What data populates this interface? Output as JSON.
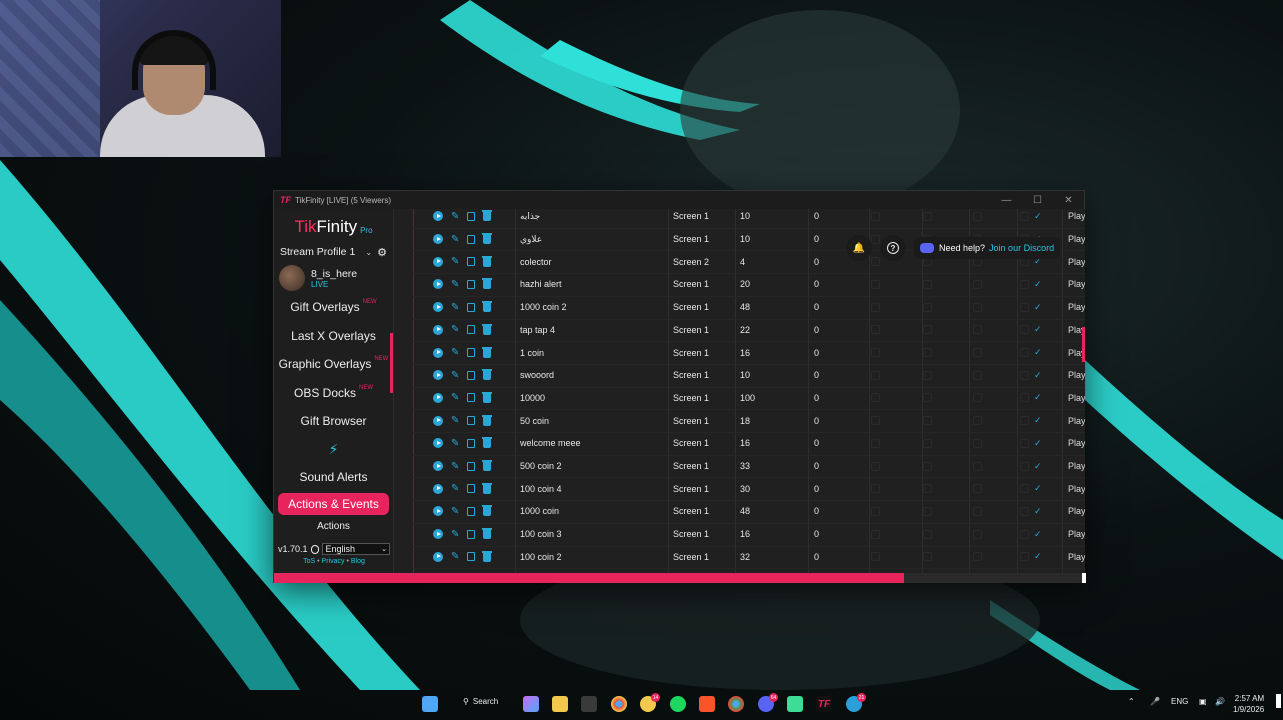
{
  "window": {
    "title": "TikFinity [LIVE] (5 Viewers)",
    "logo_short": "TF",
    "controls": [
      "—",
      "☐",
      "✕"
    ]
  },
  "brand": {
    "tik": "Tik",
    "finity": "Finity",
    "pro": "Pro"
  },
  "profile": {
    "label": "Stream Profile 1",
    "chevron": "⌄",
    "gear": "⚙"
  },
  "user": {
    "name": "8_is_here",
    "status": "LIVE"
  },
  "nav": {
    "new_badge": "NEW",
    "items": [
      {
        "label": "Gift Overlays"
      },
      {
        "label": "Last X Overlays"
      },
      {
        "label": "Graphic Overlays"
      },
      {
        "label": "OBS Docks"
      },
      {
        "label": "Gift Browser"
      }
    ],
    "divider_icon": "⚡",
    "sound_alerts": "Sound Alerts",
    "active": "Actions & Events",
    "sub": "Actions"
  },
  "footer": {
    "version": "v1.70.1",
    "language": "English",
    "tos": "ToS",
    "privacy": "Privacy",
    "blog": "Blog",
    "sep": "•"
  },
  "topbar": {
    "bell": "🔔",
    "help": "?",
    "need_help": "Need help?",
    "discord_link": "Join our Discord"
  },
  "table": {
    "check_mark": "✓",
    "play_label": "Play",
    "rows": [
      {
        "name": "جذابه",
        "screen": "Screen 1",
        "duration": "10",
        "count": "0"
      },
      {
        "name": "علاوي",
        "screen": "Screen 1",
        "duration": "10",
        "count": "0"
      },
      {
        "name": "colector",
        "screen": "Screen 2",
        "duration": "4",
        "count": "0"
      },
      {
        "name": "hazhi alert",
        "screen": "Screen 1",
        "duration": "20",
        "count": "0"
      },
      {
        "name": "1000 coin 2",
        "screen": "Screen 1",
        "duration": "48",
        "count": "0"
      },
      {
        "name": "tap tap 4",
        "screen": "Screen 1",
        "duration": "22",
        "count": "0"
      },
      {
        "name": "1 coin",
        "screen": "Screen 1",
        "duration": "16",
        "count": "0"
      },
      {
        "name": "swooord",
        "screen": "Screen 1",
        "duration": "10",
        "count": "0"
      },
      {
        "name": "10000",
        "screen": "Screen 1",
        "duration": "100",
        "count": "0"
      },
      {
        "name": "50 coin",
        "screen": "Screen 1",
        "duration": "18",
        "count": "0"
      },
      {
        "name": "welcome meee",
        "screen": "Screen 1",
        "duration": "16",
        "count": "0"
      },
      {
        "name": "500 coin 2",
        "screen": "Screen 1",
        "duration": "33",
        "count": "0"
      },
      {
        "name": "100 coin 4",
        "screen": "Screen 1",
        "duration": "30",
        "count": "0"
      },
      {
        "name": "1000 coin",
        "screen": "Screen 1",
        "duration": "48",
        "count": "0"
      },
      {
        "name": "100 coin 3",
        "screen": "Screen 1",
        "duration": "16",
        "count": "0"
      },
      {
        "name": "100 coin 2",
        "screen": "Screen 1",
        "duration": "32",
        "count": "0"
      }
    ]
  },
  "taskbar": {
    "search": "Search",
    "badge_1": "14",
    "badge_2": "64",
    "badge_3": "21",
    "lang": "ENG",
    "time": "2:57 AM",
    "date": "1/9/2026"
  },
  "colors": {
    "accent": "#e8245d",
    "link": "#29c6e2",
    "icon": "#2aa6d8"
  }
}
